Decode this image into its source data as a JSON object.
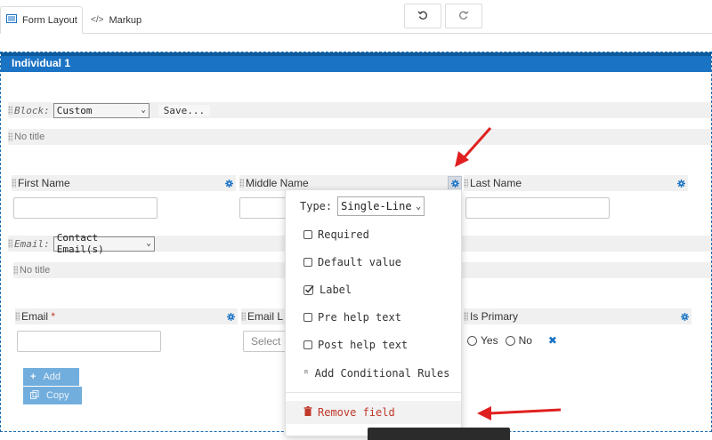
{
  "tabs": [
    {
      "label": "Form Layout",
      "icon": "form-layout-icon",
      "active": true
    },
    {
      "label": "Markup",
      "icon": "code-icon",
      "active": false
    }
  ],
  "toolbar": {
    "undo_icon": "undo-icon",
    "redo_icon": "redo-icon"
  },
  "section": {
    "title": "Individual 1"
  },
  "block": {
    "label": "Block:",
    "selected": "Custom",
    "save_label": "Save..."
  },
  "no_title_1": "No title",
  "fields_row1": {
    "first_name": "First Name",
    "middle_name": "Middle Name",
    "last_name": "Last Name"
  },
  "email_block": {
    "label": "Email:",
    "selected": "Contact Email(s)"
  },
  "no_title_2": "No title",
  "fields_row2": {
    "email": "Email",
    "required_mark": "*",
    "email_location": "Email L",
    "email_location_placeholder": "Select",
    "is_primary": "Is Primary",
    "yes_label": "Yes",
    "no_label": "No"
  },
  "buttons": {
    "add": "Add",
    "copy": "Copy"
  },
  "menu": {
    "type_label": "Type:",
    "type_value": "Single-Line",
    "items": [
      {
        "label": "Required",
        "checked": false
      },
      {
        "label": "Default value",
        "checked": false
      },
      {
        "label": "Label",
        "checked": true
      },
      {
        "label": "Pre help text",
        "checked": false
      },
      {
        "label": "Post help text",
        "checked": false
      }
    ],
    "conditional": "Add Conditional Rules",
    "remove": "Remove field"
  },
  "colors": {
    "accent": "#1a73c4",
    "danger": "#c0392b",
    "arrow": "#e02020"
  }
}
